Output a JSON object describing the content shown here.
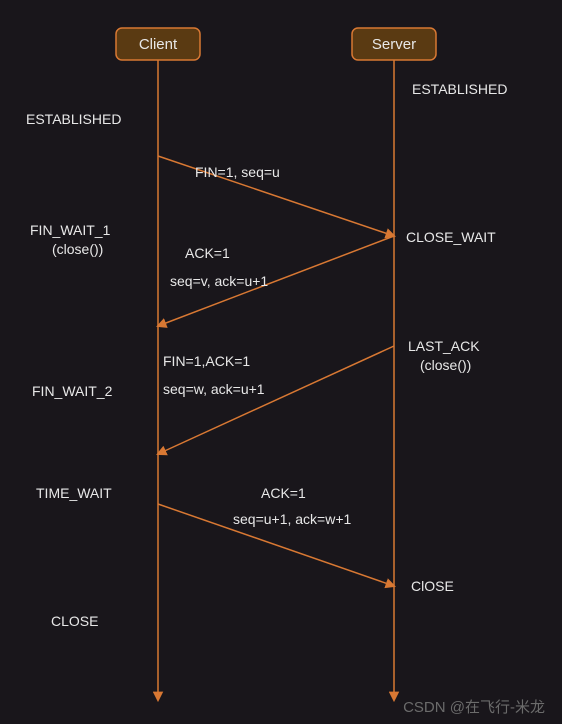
{
  "actors": {
    "client": "Client",
    "server": "Server"
  },
  "states": {
    "client_established": "ESTABLISHED",
    "server_established": "ESTABLISHED",
    "fin_wait_1_line1": "FIN_WAIT_1",
    "fin_wait_1_line2": "(close())",
    "close_wait": "CLOSE_WAIT",
    "fin_wait_2": "FIN_WAIT_2",
    "last_ack_line1": "LAST_ACK",
    "last_ack_line2": "(close())",
    "time_wait": "TIME_WAIT",
    "server_close": "ClOSE",
    "client_close": "CLOSE"
  },
  "messages": {
    "m1": "FIN=1, seq=u",
    "m2_line1": "ACK=1",
    "m2_line2": "seq=v, ack=u+1",
    "m3_line1": "FIN=1,ACK=1",
    "m3_line2": "seq=w, ack=u+1",
    "m4_line1": "ACK=1",
    "m4_line2": "seq=u+1, ack=w+1"
  },
  "watermark": "CSDN @在飞行-米龙",
  "colors": {
    "bg": "#19161b",
    "line": "#d87833",
    "boxfill": "#5a3a12",
    "text": "#e8e8e8"
  }
}
